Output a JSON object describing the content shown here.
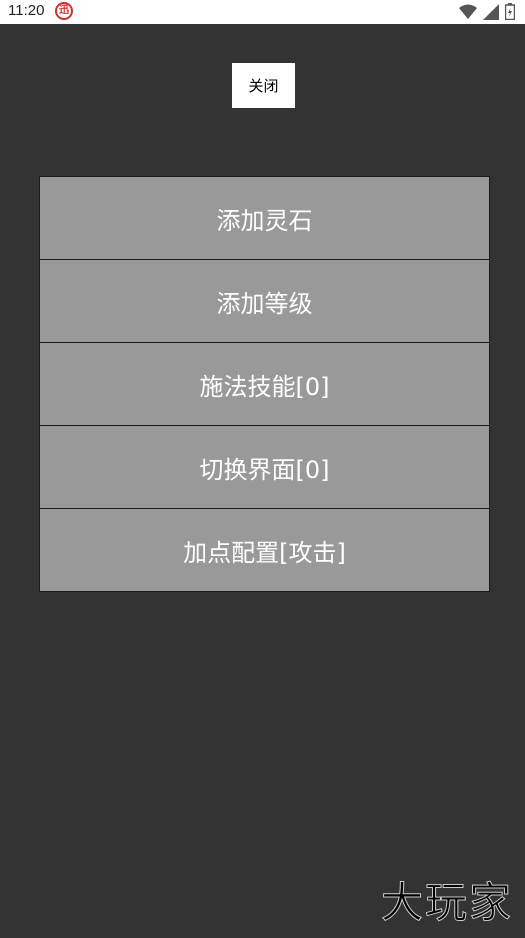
{
  "status_bar": {
    "time": "11:20",
    "badge_icon": "app-notification-icon",
    "badge_char": "迅",
    "icons": [
      "wifi-icon",
      "signal-icon",
      "battery-icon"
    ]
  },
  "close_button": {
    "label": "关闭"
  },
  "menu": {
    "items": [
      {
        "label": "添加灵石"
      },
      {
        "label": "添加等级"
      },
      {
        "label": "施法技能[0]"
      },
      {
        "label": "切换界面[0]"
      },
      {
        "label": "加点配置[攻击]"
      }
    ]
  },
  "watermark": {
    "text": "大玩家"
  },
  "colors": {
    "background": "#333333",
    "menu_item": "#999999",
    "menu_text": "#ffffff",
    "badge": "#d32f2f"
  }
}
